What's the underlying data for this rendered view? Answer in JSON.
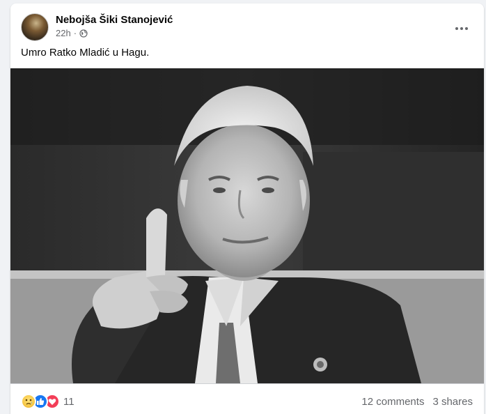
{
  "post": {
    "author": "Nebojša Šiki Stanojević",
    "time": "22h",
    "separator": "·",
    "audience_icon": "globe-icon",
    "text": "Umro Ratko Mladić u Hagu.",
    "photo": "black-and-white portrait photo",
    "more_icon": "more-options-icon"
  },
  "footer": {
    "reaction_icons": [
      "sad-reaction-icon",
      "like-reaction-icon",
      "love-reaction-icon"
    ],
    "reaction_count": "11",
    "comments": "12 comments",
    "shares": "3 shares"
  },
  "colors": {
    "like": "#1877f2",
    "love": "#f33e58",
    "sad": "#f7c948",
    "secondary_text": "#65676b"
  }
}
